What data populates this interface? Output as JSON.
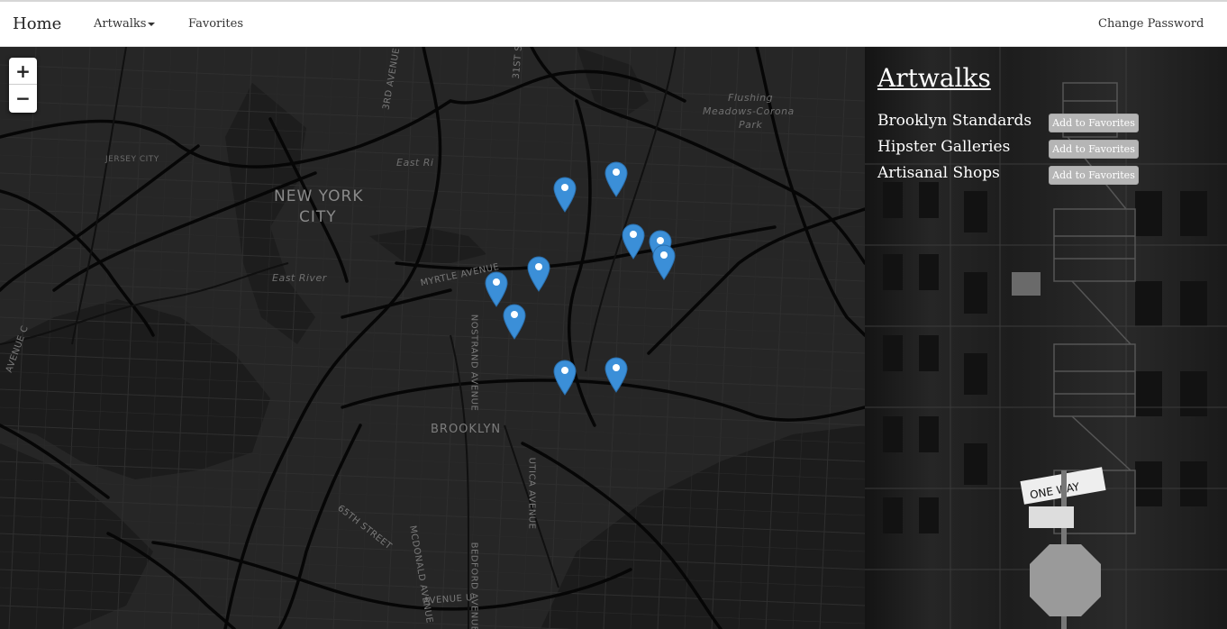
{
  "nav": {
    "brand": "Home",
    "artwalks": "Artwalks",
    "favorites": "Favorites",
    "change_password": "Change Password"
  },
  "map": {
    "zoom_in": "+",
    "zoom_out": "−",
    "labels": {
      "new_york_city_1": "NEW YORK",
      "new_york_city_2": "CITY",
      "brooklyn": "BROOKLYN",
      "jersey_city": "JERSEY CITY",
      "flushing_1": "Flushing",
      "flushing_2": "Meadows-Corona",
      "flushing_3": "Park",
      "east_river_1": "East River",
      "east_river_2": "East Ri",
      "myrtle": "MYRTLE AVENUE",
      "nostrand": "NOSTRAND AVENUE",
      "utica": "UTICA AVENUE",
      "bedford": "BEDFORD AVENUE",
      "mcdonald": "MCDONALD AVENUE",
      "avenue_u": "AVENUE U",
      "th65": "65TH STREET",
      "broadway": "3RD AVENUE",
      "st31": "31ST ST",
      "avenue_c": "AVENUE C"
    },
    "markers": [
      {
        "id": "m1",
        "lng": -73.944,
        "lat": 40.724
      },
      {
        "id": "m2",
        "lng": -73.921,
        "lat": 40.729
      },
      {
        "id": "m3",
        "lng": -73.913,
        "lat": 40.708
      },
      {
        "id": "m4",
        "lng": -73.901,
        "lat": 40.706
      },
      {
        "id": "m5",
        "lng": -73.899,
        "lat": 40.701
      },
      {
        "id": "m6",
        "lng": -73.956,
        "lat": 40.697
      },
      {
        "id": "m7",
        "lng": -73.975,
        "lat": 40.692
      },
      {
        "id": "m8",
        "lng": -73.967,
        "lat": 40.681
      },
      {
        "id": "m9",
        "lng": -73.944,
        "lat": 40.662
      },
      {
        "id": "m10",
        "lng": -73.921,
        "lat": 40.663
      }
    ]
  },
  "sidebar": {
    "title": "Artwalks",
    "walks": [
      {
        "name": "Brooklyn Standards",
        "button": "Add to Favorites"
      },
      {
        "name": "Hipster Galleries",
        "button": "Add to Favorites"
      },
      {
        "name": "Artisanal Shops",
        "button": "Add to Favorites"
      }
    ]
  },
  "colors": {
    "marker": "#3b8fd8",
    "map_bg": "#232323",
    "road": "#050505",
    "button": "#b5b5b5"
  }
}
